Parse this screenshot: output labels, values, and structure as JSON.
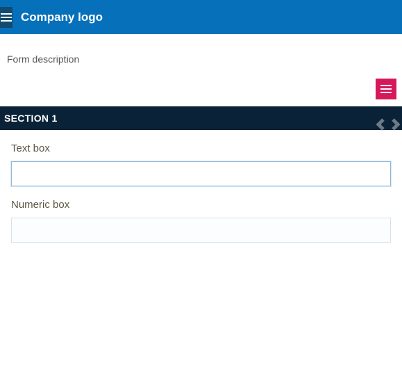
{
  "header": {
    "logo_label": "Company logo"
  },
  "form": {
    "description": "Form description"
  },
  "section": {
    "title": "SECTION 1"
  },
  "fields": {
    "textbox": {
      "label": "Text box",
      "value": "",
      "placeholder": ""
    },
    "numeric": {
      "label": "Numeric box",
      "value": "",
      "placeholder": ""
    }
  },
  "colors": {
    "brand": "#0671BA",
    "section_bg": "#0A2237",
    "accent": "#D6195B"
  }
}
